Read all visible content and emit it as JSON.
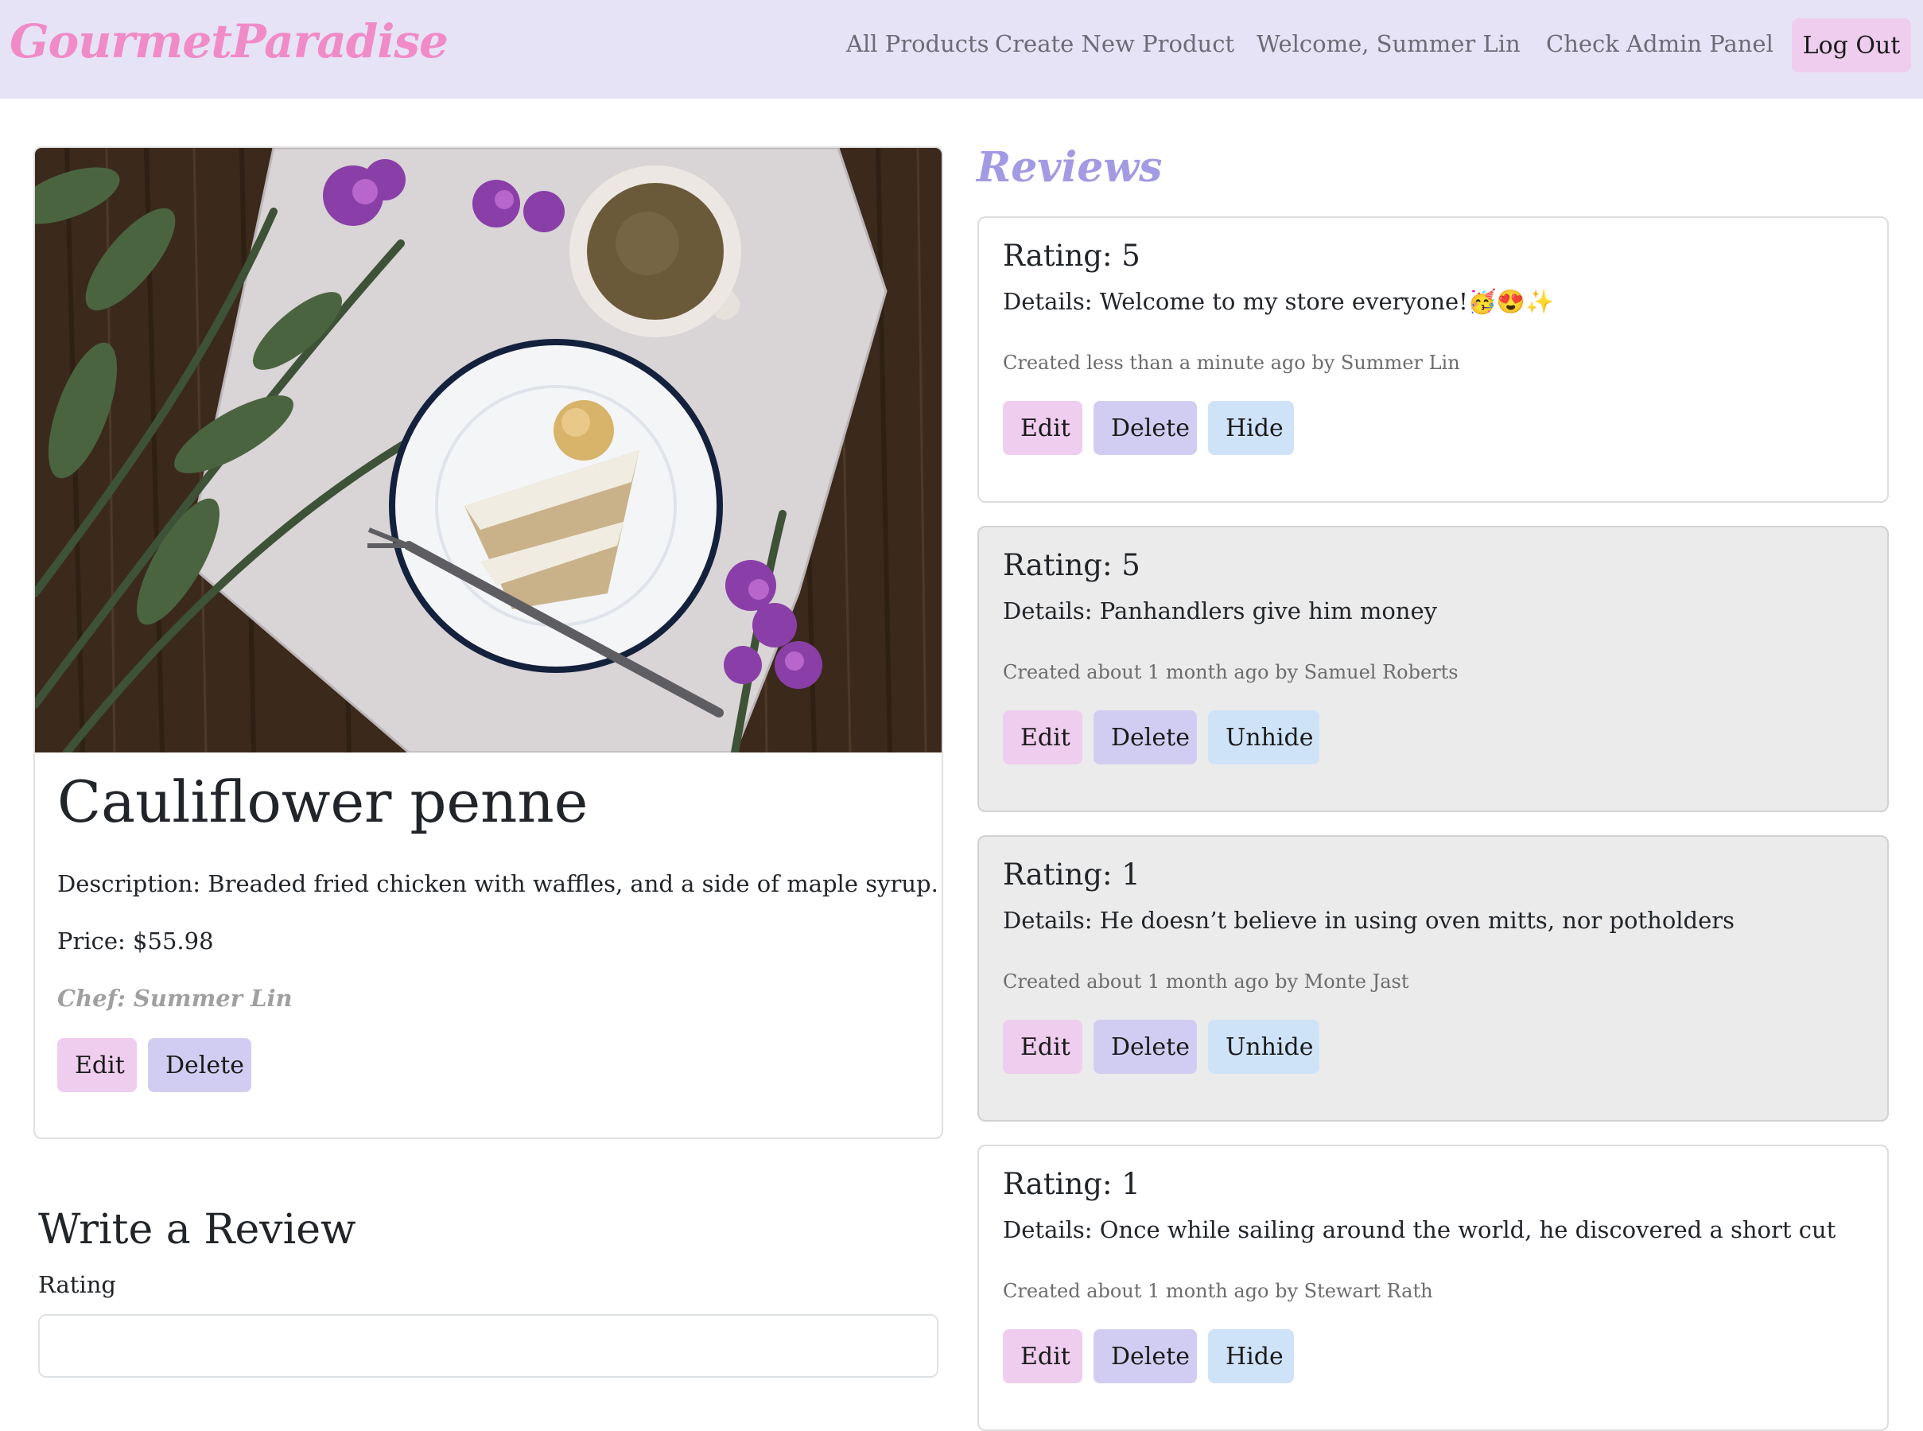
{
  "nav": {
    "brand": "GourmetParadise",
    "all_products": "All Products",
    "create_product": "Create New Product",
    "welcome": "Welcome, Summer Lin",
    "admin_panel": "Check Admin Panel",
    "logout": "Log Out"
  },
  "product": {
    "title": "Cauliflower penne",
    "description": "Description: Breaded fried chicken with waffles, and a side of maple syrup.",
    "price": "Price: $55.98",
    "chef": "Chef: Summer Lin",
    "edit_label": "Edit",
    "delete_label": "Delete"
  },
  "write_review": {
    "title": "Write a Review",
    "rating_label": "Rating",
    "rating_value": ""
  },
  "reviews": {
    "title": "Reviews",
    "items": [
      {
        "rating": "Rating: 5",
        "details": "Details: Welcome to my store everyone!🥳😍✨",
        "meta": "Created less than a minute ago by Summer Lin",
        "edit": "Edit",
        "delete": "Delete",
        "toggle": "Hide",
        "hidden": false
      },
      {
        "rating": "Rating: 5",
        "details": "Details: Panhandlers give him money",
        "meta": "Created about 1 month ago by Samuel Roberts",
        "edit": "Edit",
        "delete": "Delete",
        "toggle": "Unhide",
        "hidden": true
      },
      {
        "rating": "Rating: 1",
        "details": "Details: He doesn’t believe in using oven mitts, nor potholders",
        "meta": "Created about 1 month ago by Monte Jast",
        "edit": "Edit",
        "delete": "Delete",
        "toggle": "Unhide",
        "hidden": true
      },
      {
        "rating": "Rating: 1",
        "details": "Details: Once while sailing around the world, he discovered a short cut",
        "meta": "Created about 1 month ago by Stewart Rath",
        "edit": "Edit",
        "delete": "Delete",
        "toggle": "Hide",
        "hidden": false
      }
    ]
  },
  "colors": {
    "navbar_bg": "#e6e3f6",
    "brand": "#f08bc8",
    "reviews_title": "#a29ae3",
    "btn_edit": "#efcdee",
    "btn_delete": "#d1cdf2",
    "btn_hide": "#cfe3f8",
    "hidden_review_bg": "#ebebeb"
  }
}
